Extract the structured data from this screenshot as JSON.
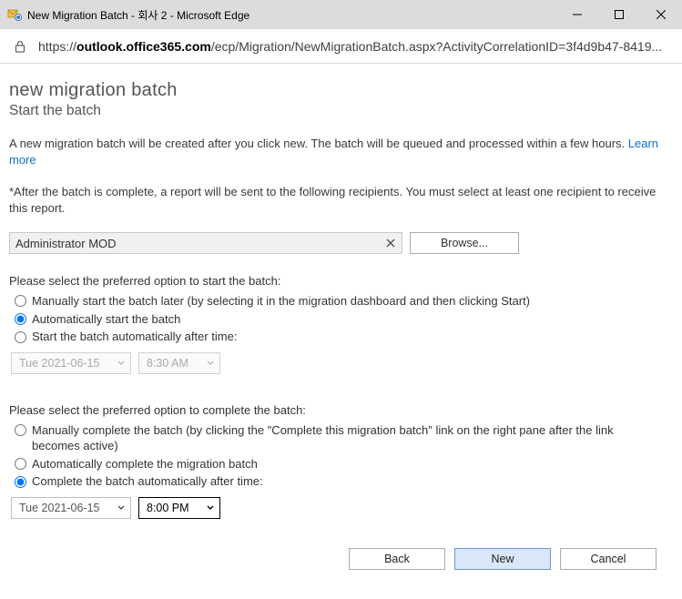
{
  "window": {
    "title": "New Migration Batch - 회사 2 - Microsoft Edge"
  },
  "addressbar": {
    "host": "outlook.office365.com",
    "prefix": "https://",
    "path": "/ecp/Migration/NewMigrationBatch.aspx?ActivityCorrelationID=3f4d9b47-8419..."
  },
  "page": {
    "heading": "new migration batch",
    "subheading": "Start the batch",
    "intro": "A new migration batch will be created after you click new. The batch will be queued and processed within a few hours.",
    "learn_more": "Learn more",
    "report_note": "*After the batch is complete, a report will be sent to the following recipients. You must select at least one recipient to receive this report.",
    "recipient": "Administrator MOD",
    "browse": "Browse...",
    "start_section_label": "Please select the preferred option to start the batch:",
    "start_options": {
      "manual": "Manually start the batch later (by selecting it in the migration dashboard and then clicking Start)",
      "auto": "Automatically start the batch",
      "after": "Start the batch automatically after time:"
    },
    "start_date": "Tue 2021-06-15",
    "start_time": "8:30 AM",
    "complete_section_label": "Please select the preferred option to complete the batch:",
    "complete_options": {
      "manual": "Manually complete the batch (by clicking the \"Complete this migration batch\" link on the right pane after the link becomes active)",
      "auto": "Automatically complete the migration batch",
      "after": "Complete the batch automatically after time:"
    },
    "complete_date": "Tue 2021-06-15",
    "complete_time": "8:00 PM"
  },
  "footer": {
    "back": "Back",
    "next": "New",
    "cancel": "Cancel"
  }
}
